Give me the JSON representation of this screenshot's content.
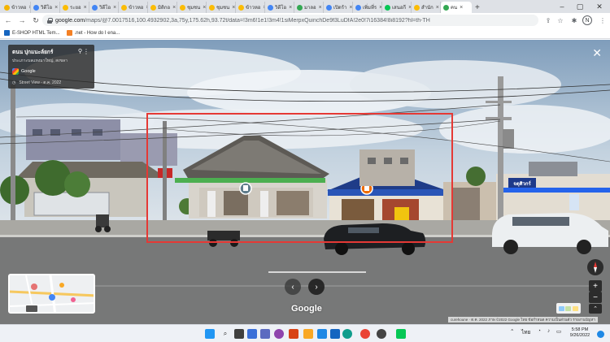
{
  "browser": {
    "tabs": [
      {
        "label": "ข้าวหอ",
        "color": "#f4b400"
      },
      {
        "label": "วิดีโอ",
        "color": "#4285f4"
      },
      {
        "label": "ระยอ",
        "color": "#fbbc05"
      },
      {
        "label": "วิดีโอ",
        "color": "#4285f4"
      },
      {
        "label": "ข้าวหอ",
        "color": "#fbbc05"
      },
      {
        "label": "มิติกอ",
        "color": "#fbbc05"
      },
      {
        "label": "ชุมชน",
        "color": "#fbbc05"
      },
      {
        "label": "ชุมชน",
        "color": "#fbbc05"
      },
      {
        "label": "ข้าวหอ",
        "color": "#fbbc05"
      },
      {
        "label": "วิดีโอ",
        "color": "#4285f4"
      },
      {
        "label": "มาลอ",
        "color": "#34a853"
      },
      {
        "label": "เปิดร้า",
        "color": "#4285f4"
      },
      {
        "label": "เพิ่มที่ร",
        "color": "#4285f4"
      },
      {
        "label": "เสนอกี",
        "color": "#06c755"
      },
      {
        "label": "สำนัก",
        "color": "#fbbc05"
      },
      {
        "label": "คน",
        "color": "#34a853",
        "active": true
      }
    ],
    "new_tab": "+",
    "url_domain": "google.com",
    "url_path": "/maps/@7.0017516,100.4932902,3a,75y,175.62h,93.72t/data=!3m6!1e1!3m4!1siMerpxQuinchDe9f3LuDfA!2e0!7i16384!8i8192?hl=th-TH",
    "profile_initial": "N",
    "bookmarks": [
      {
        "label": "E-SHOP HTML Tem...",
        "color": "#1565c0"
      },
      {
        "label": ".net - How do I ena...",
        "color": "#f48024"
      }
    ]
  },
  "streetview": {
    "place_name": "ตนน ปุกแนะล์ยกร์",
    "address": "ประเภาะบลแหงมาใหญ่, สงขลา",
    "provider": "Google",
    "date_label": "Street View - ต.ค. 2022",
    "google_logo": "Google",
    "attribution": "ภาพ ©2022 Google   ไทย   ข้อกำหนด   ความเป็นส่วนตัว   รายงานปัญหา",
    "attribution_prefix": "curehoune · ต.ค. 2022",
    "shop_sign_1": "อาหารทะเล",
    "shop_sign_2": "จตุศิวกร์",
    "selection_highlight_color": "#e53935"
  },
  "taskbar": {
    "time": "5:58 PM",
    "date": "9/26/2022",
    "lang": "ไทย"
  }
}
